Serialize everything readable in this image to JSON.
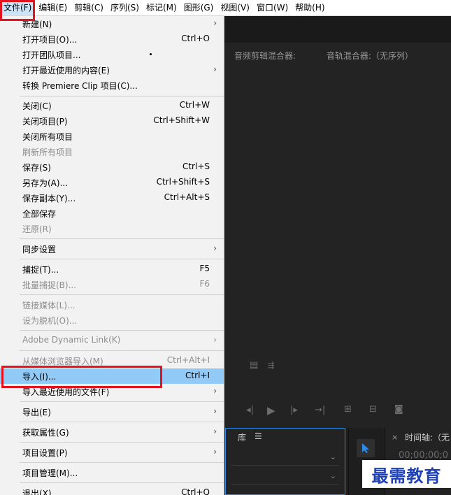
{
  "menubar": {
    "items": [
      "文件(F)",
      "编辑(E)",
      "剪辑(C)",
      "序列(S)",
      "标记(M)",
      "图形(G)",
      "视图(V)",
      "窗口(W)",
      "帮助(H)"
    ]
  },
  "file_menu": {
    "new": {
      "label": "新建(N)"
    },
    "open_project": {
      "label": "打开项目(O)...",
      "shortcut": "Ctrl+O"
    },
    "open_team_project": {
      "label": "打开团队项目..."
    },
    "open_recent": {
      "label": "打开最近使用的内容(E)"
    },
    "convert_clip": {
      "label": "转换 Premiere Clip 项目(C)..."
    },
    "close": {
      "label": "关闭(C)",
      "shortcut": "Ctrl+W"
    },
    "close_project": {
      "label": "关闭项目(P)",
      "shortcut": "Ctrl+Shift+W"
    },
    "close_all": {
      "label": "关闭所有项目"
    },
    "refresh_all": {
      "label": "刷新所有项目"
    },
    "save": {
      "label": "保存(S)",
      "shortcut": "Ctrl+S"
    },
    "save_as": {
      "label": "另存为(A)...",
      "shortcut": "Ctrl+Shift+S"
    },
    "save_copy": {
      "label": "保存副本(Y)...",
      "shortcut": "Ctrl+Alt+S"
    },
    "save_all": {
      "label": "全部保存"
    },
    "revert": {
      "label": "还原(R)"
    },
    "sync_settings": {
      "label": "同步设置"
    },
    "capture": {
      "label": "捕捉(T)...",
      "shortcut": "F5"
    },
    "batch_capture": {
      "label": "批量捕捉(B)...",
      "shortcut": "F6"
    },
    "link_media": {
      "label": "链接媒体(L)..."
    },
    "make_offline": {
      "label": "设为脱机(O)..."
    },
    "dynamic_link": {
      "label": "Adobe Dynamic Link(K)"
    },
    "import_from_browser": {
      "label": "从媒体浏览器导入(M)",
      "shortcut": "Ctrl+Alt+I"
    },
    "import": {
      "label": "导入(I)...",
      "shortcut": "Ctrl+I"
    },
    "import_recent": {
      "label": "导入最近使用的文件(F)"
    },
    "export": {
      "label": "导出(E)"
    },
    "get_properties": {
      "label": "获取属性(G)"
    },
    "project_settings": {
      "label": "项目设置(P)"
    },
    "project_manager": {
      "label": "项目管理(M)..."
    },
    "exit": {
      "label": "退出(X)",
      "shortcut": "Ctrl+Q"
    },
    "submenu_arrow": "›"
  },
  "background": {
    "audio_clip_mixer": "音频剪辑混合器:",
    "audio_track_mixer": "音轨混合器:（无序列）",
    "library_tab": "库",
    "panel_menu": "☰",
    "timeline_close": "×",
    "timeline_title": "时间轴:（无",
    "timecode": "00;00;00;0"
  },
  "watermark": {
    "text": "最需教育"
  }
}
